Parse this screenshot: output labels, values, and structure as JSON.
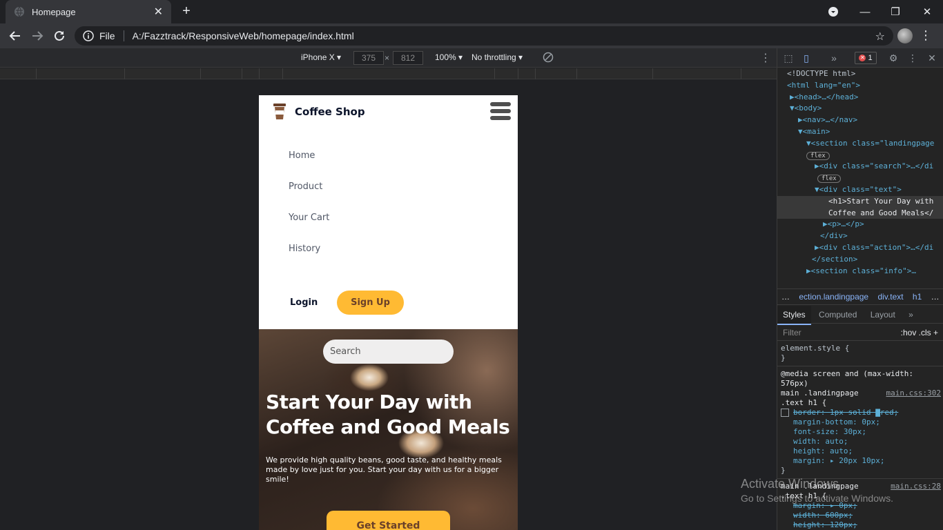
{
  "browser": {
    "tab_title": "Homepage",
    "file_label": "File",
    "url": "A:/Fazztrack/ResponsiveWeb/homepage/index.html"
  },
  "device_toolbar": {
    "device": "iPhone X ▾",
    "width": "375",
    "height": "812",
    "times": "×",
    "zoom": "100% ▾",
    "throttling": "No throttling ▾"
  },
  "site": {
    "brand": "Coffee Shop",
    "menu": [
      "Home",
      "Product",
      "Your Cart",
      "History"
    ],
    "login": "Login",
    "signup": "Sign Up",
    "search_placeholder": "Search",
    "hero_title_1": "Start Your Day with",
    "hero_title_2": "Coffee and Good Meals",
    "hero_text": "We provide high quality beans, good taste, and healthy meals made by love just for you. Start your day with us for a bigger smile!",
    "cta": "Get Started"
  },
  "devtools": {
    "error_count": "1",
    "dom": [
      "<!DOCTYPE html>",
      "<html lang=\"en\">",
      "▶<head>…</head>",
      "▼<body>",
      "▶<nav>…</nav>",
      "▼<main>",
      "▼<section class=\"landingpage",
      "flex",
      "▶<div class=\"search\">…</di",
      "flex",
      "▼<div class=\"text\">",
      "<h1>Start Your Day with",
      "Coffee and Good Meals</",
      "▶<p>…</p>",
      "</div>",
      "▶<div class=\"action\">…</di",
      "</section>",
      "▶<section class=\"info\">…"
    ],
    "crumbs": [
      "…",
      "ection.landingpage",
      "div.text",
      "h1",
      "…"
    ],
    "style_tabs": [
      "Styles",
      "Computed",
      "Layout",
      "»"
    ],
    "filter": "Filter",
    "filter_tools": ":hov  .cls  +",
    "styles": {
      "element_style": "element.style {",
      "close": "}",
      "media": "@media screen and (max-width: 576px)",
      "selector1": "main .landingpage .text h1 {",
      "src1": "main.css:302",
      "props1": [
        "border: 1px solid ▇red;",
        "margin-bottom: 0px;",
        "font-size: 30px;",
        "width: auto;",
        "height: auto;",
        "margin: ▸ 20px 10px;"
      ],
      "selector2": "main .landingpage .text h1 {",
      "src2": "main.css:28",
      "props2": [
        "margin: ▸ 0px;",
        "width: 600px;",
        "height: 120px;"
      ]
    }
  },
  "os": {
    "activate_title": "Activate Windows",
    "activate_sub": "Go to Settings to activate Windows."
  }
}
